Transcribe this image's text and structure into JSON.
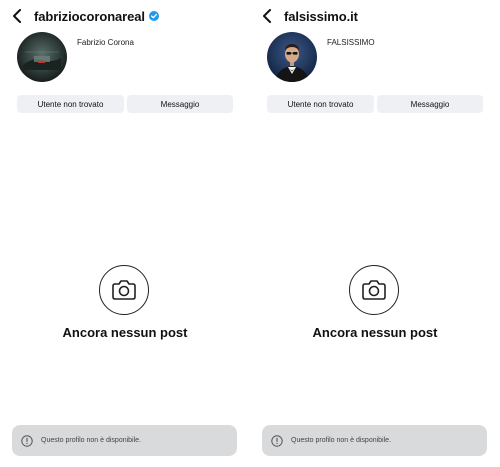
{
  "panels": [
    {
      "username": "fabriziocoronareal",
      "verified": true,
      "full_name": "Fabrizio Corona",
      "buttons": [
        "Utente non trovato",
        "Messaggio"
      ],
      "empty_state": "Ancora nessun post",
      "toast": "Questo profilo non è disponibile."
    },
    {
      "username": "falsissimo.it",
      "verified": false,
      "full_name": "FALSISSIMO",
      "buttons": [
        "Utente non trovato",
        "Messaggio"
      ],
      "empty_state": "Ancora nessun post",
      "toast": "Questo profilo non è disponibile."
    }
  ],
  "colors": {
    "verified_badge": "#1d9bf0",
    "button_bg": "#eef0f3",
    "toast_bg": "#d9dadc"
  }
}
